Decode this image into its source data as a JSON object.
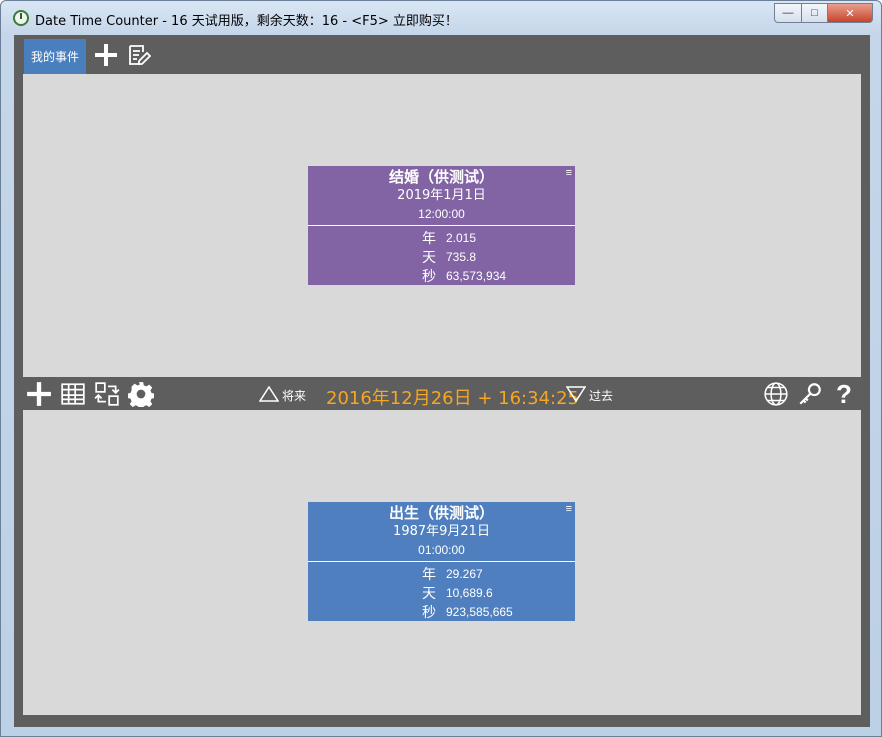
{
  "window": {
    "title": "Date Time Counter - 16 天试用版，剩余天数：16 - <F5> 立即购买！",
    "min_label": "—",
    "max_label": "□",
    "close_label": "✕"
  },
  "tabs": {
    "active_label": "我的事件",
    "add_icon": "plus-icon",
    "edit_icon": "edit-icon"
  },
  "events_top": [
    {
      "title": "结婚（供测试）",
      "date": "2019年1月1日",
      "time": "12:00:00",
      "menu": "≡",
      "color": "#8264a4",
      "rows": [
        {
          "unit": "年",
          "value": "2.015"
        },
        {
          "unit": "天",
          "value": "735.8"
        },
        {
          "unit": "秒",
          "value": "63,573,934"
        }
      ]
    }
  ],
  "toolbar": {
    "add_icon": "plus-icon",
    "table_icon": "table-icon",
    "swap_icon": "swap-icon",
    "settings_icon": "gear-icon",
    "future_label": "将来",
    "past_label": "过去",
    "current_datetime": "2016年12月26日 + 16:34:25",
    "globe_icon": "globe-icon",
    "key_icon": "key-icon",
    "help_icon": "help-icon",
    "help_label": "?"
  },
  "events_bottom": [
    {
      "title": "出生（供测试）",
      "date": "1987年9月21日",
      "time": "01:00:00",
      "menu": "≡",
      "color": "#4f7fbf",
      "rows": [
        {
          "unit": "年",
          "value": "29.267"
        },
        {
          "unit": "天",
          "value": "10,689.6"
        },
        {
          "unit": "秒",
          "value": "923,585,665"
        }
      ]
    }
  ],
  "colors": {
    "accent_orange": "#f5a623",
    "tab_blue": "#4a7fbd",
    "frame_gray": "#5e5e5e",
    "panel_gray": "#d9d9d9"
  }
}
